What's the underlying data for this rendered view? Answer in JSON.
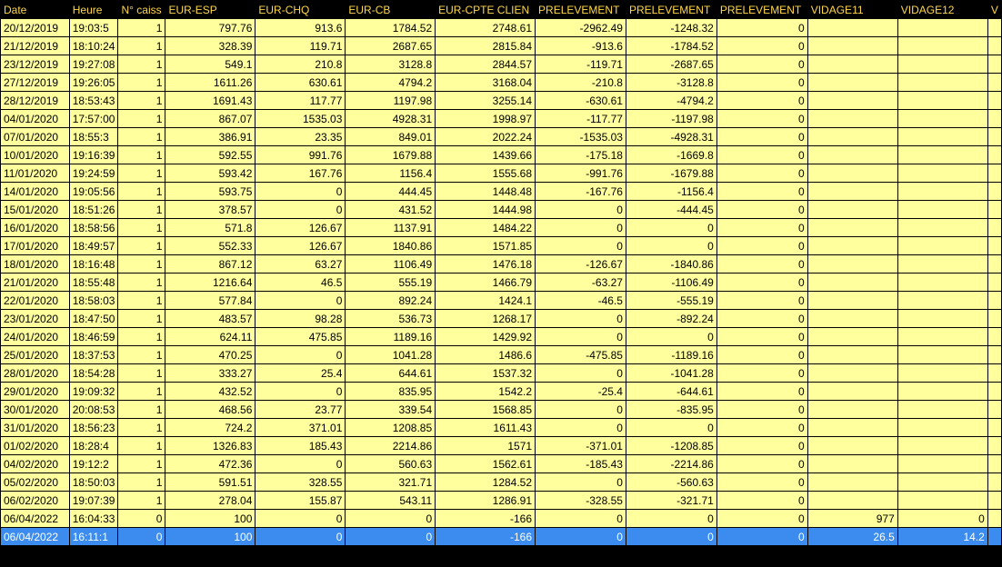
{
  "columns": [
    "Date",
    "Heure",
    "N° caiss",
    "EUR-ESP",
    "EUR-CHQ",
    "EUR-CB",
    "EUR-CPTE CLIEN",
    "PRELEVEMENT",
    "PRELEVEMENT",
    "PRELEVEMENT",
    "VIDAGE11",
    "VIDAGE12",
    "V"
  ],
  "rows": [
    [
      "20/12/2019",
      "19:03:5",
      "1",
      "797.76",
      "913.6",
      "1784.52",
      "2748.61",
      "-2962.49",
      "-1248.32",
      "0",
      "",
      ""
    ],
    [
      "21/12/2019",
      "18:10:24",
      "1",
      "328.39",
      "119.71",
      "2687.65",
      "2815.84",
      "-913.6",
      "-1784.52",
      "0",
      "",
      ""
    ],
    [
      "23/12/2019",
      "19:27:08",
      "1",
      "549.1",
      "210.8",
      "3128.8",
      "2844.57",
      "-119.71",
      "-2687.65",
      "0",
      "",
      ""
    ],
    [
      "27/12/2019",
      "19:26:05",
      "1",
      "1611.26",
      "630.61",
      "4794.2",
      "3168.04",
      "-210.8",
      "-3128.8",
      "0",
      "",
      ""
    ],
    [
      "28/12/2019",
      "18:53:43",
      "1",
      "1691.43",
      "117.77",
      "1197.98",
      "3255.14",
      "-630.61",
      "-4794.2",
      "0",
      "",
      ""
    ],
    [
      "04/01/2020",
      "17:57:00",
      "1",
      "867.07",
      "1535.03",
      "4928.31",
      "1998.97",
      "-117.77",
      "-1197.98",
      "0",
      "",
      ""
    ],
    [
      "07/01/2020",
      "18:55:3",
      "1",
      "386.91",
      "23.35",
      "849.01",
      "2022.24",
      "-1535.03",
      "-4928.31",
      "0",
      "",
      ""
    ],
    [
      "10/01/2020",
      "19:16:39",
      "1",
      "592.55",
      "991.76",
      "1679.88",
      "1439.66",
      "-175.18",
      "-1669.8",
      "0",
      "",
      ""
    ],
    [
      "11/01/2020",
      "19:24:59",
      "1",
      "593.42",
      "167.76",
      "1156.4",
      "1555.68",
      "-991.76",
      "-1679.88",
      "0",
      "",
      ""
    ],
    [
      "14/01/2020",
      "19:05:56",
      "1",
      "593.75",
      "0",
      "444.45",
      "1448.48",
      "-167.76",
      "-1156.4",
      "0",
      "",
      ""
    ],
    [
      "15/01/2020",
      "18:51:26",
      "1",
      "378.57",
      "0",
      "431.52",
      "1444.98",
      "0",
      "-444.45",
      "0",
      "",
      ""
    ],
    [
      "16/01/2020",
      "18:58:56",
      "1",
      "571.8",
      "126.67",
      "1137.91",
      "1484.22",
      "0",
      "0",
      "0",
      "",
      ""
    ],
    [
      "17/01/2020",
      "18:49:57",
      "1",
      "552.33",
      "126.67",
      "1840.86",
      "1571.85",
      "0",
      "0",
      "0",
      "",
      ""
    ],
    [
      "18/01/2020",
      "18:16:48",
      "1",
      "867.12",
      "63.27",
      "1106.49",
      "1476.18",
      "-126.67",
      "-1840.86",
      "0",
      "",
      ""
    ],
    [
      "21/01/2020",
      "18:55:48",
      "1",
      "1216.64",
      "46.5",
      "555.19",
      "1466.79",
      "-63.27",
      "-1106.49",
      "0",
      "",
      ""
    ],
    [
      "22/01/2020",
      "18:58:03",
      "1",
      "577.84",
      "0",
      "892.24",
      "1424.1",
      "-46.5",
      "-555.19",
      "0",
      "",
      ""
    ],
    [
      "23/01/2020",
      "18:47:50",
      "1",
      "483.57",
      "98.28",
      "536.73",
      "1268.17",
      "0",
      "-892.24",
      "0",
      "",
      ""
    ],
    [
      "24/01/2020",
      "18:46:59",
      "1",
      "624.11",
      "475.85",
      "1189.16",
      "1429.92",
      "0",
      "0",
      "0",
      "",
      ""
    ],
    [
      "25/01/2020",
      "18:37:53",
      "1",
      "470.25",
      "0",
      "1041.28",
      "1486.6",
      "-475.85",
      "-1189.16",
      "0",
      "",
      ""
    ],
    [
      "28/01/2020",
      "18:54:28",
      "1",
      "333.27",
      "25.4",
      "644.61",
      "1537.32",
      "0",
      "-1041.28",
      "0",
      "",
      ""
    ],
    [
      "29/01/2020",
      "19:09:32",
      "1",
      "432.52",
      "0",
      "835.95",
      "1542.2",
      "-25.4",
      "-644.61",
      "0",
      "",
      ""
    ],
    [
      "30/01/2020",
      "20:08:53",
      "1",
      "468.56",
      "23.77",
      "339.54",
      "1568.85",
      "0",
      "-835.95",
      "0",
      "",
      ""
    ],
    [
      "31/01/2020",
      "18:56:23",
      "1",
      "724.2",
      "371.01",
      "1208.85",
      "1611.43",
      "0",
      "0",
      "0",
      "",
      ""
    ],
    [
      "01/02/2020",
      "18:28:4",
      "1",
      "1326.83",
      "185.43",
      "2214.86",
      "1571",
      "-371.01",
      "-1208.85",
      "0",
      "",
      ""
    ],
    [
      "04/02/2020",
      "19:12:2",
      "1",
      "472.36",
      "0",
      "560.63",
      "1562.61",
      "-185.43",
      "-2214.86",
      "0",
      "",
      ""
    ],
    [
      "05/02/2020",
      "18:50:03",
      "1",
      "591.51",
      "328.55",
      "321.71",
      "1284.52",
      "0",
      "-560.63",
      "0",
      "",
      ""
    ],
    [
      "06/02/2020",
      "19:07:39",
      "1",
      "278.04",
      "155.87",
      "543.11",
      "1286.91",
      "-328.55",
      "-321.71",
      "0",
      "",
      ""
    ],
    [
      "06/04/2022",
      "16:04:33",
      "0",
      "100",
      "0",
      "0",
      "-166",
      "0",
      "0",
      "0",
      "977",
      "0"
    ],
    [
      "06/04/2022",
      "16:11:1",
      "0",
      "100",
      "0",
      "0",
      "-166",
      "0",
      "0",
      "0",
      "26.5",
      "14.2"
    ]
  ],
  "selected_row": 28
}
